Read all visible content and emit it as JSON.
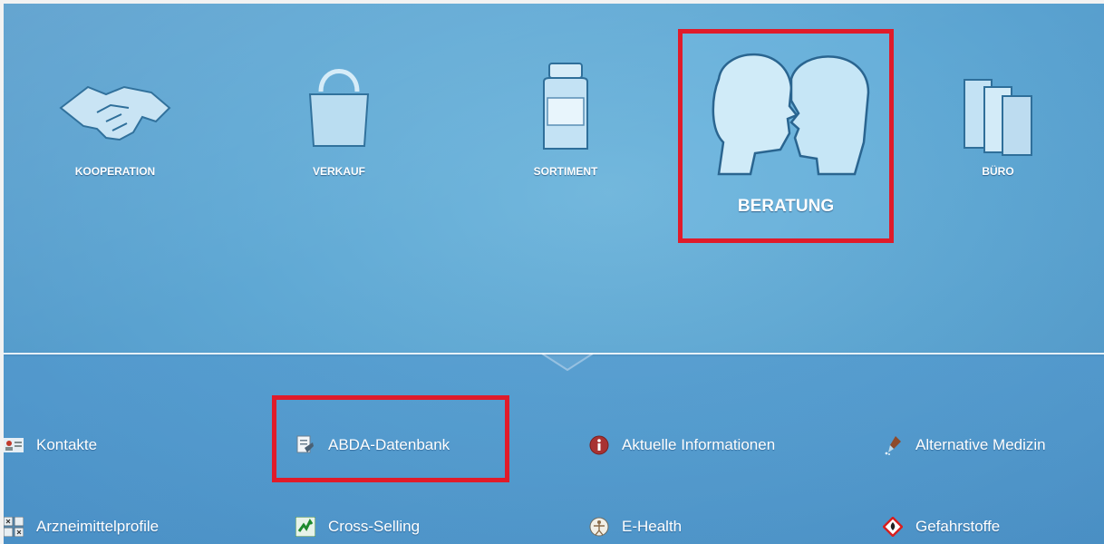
{
  "categories": [
    {
      "id": "kooperation",
      "label": "KOOPERATION",
      "icon": "handshake-icon"
    },
    {
      "id": "verkauf",
      "label": "VERKAUF",
      "icon": "shopping-bag-icon"
    },
    {
      "id": "sortiment",
      "label": "SORTIMENT",
      "icon": "medicine-bottle-icon"
    },
    {
      "id": "beratung",
      "label": "BERATUNG",
      "icon": "two-heads-icon",
      "selected": true
    },
    {
      "id": "buero",
      "label": "BÜRO",
      "icon": "binders-icon"
    }
  ],
  "submenu": {
    "items": [
      {
        "label": "Kontakte",
        "icon": "contact-card-icon"
      },
      {
        "label": "ABDA-Datenbank",
        "icon": "database-document-icon",
        "highlighted": true
      },
      {
        "label": "Aktuelle Informationen",
        "icon": "info-icon"
      },
      {
        "label": "Alternative Medizin",
        "icon": "dropper-icon"
      },
      {
        "label": "Arzneimittelprofile",
        "icon": "profile-grid-icon"
      },
      {
        "label": "Cross-Selling",
        "icon": "cross-selling-icon"
      },
      {
        "label": "E-Health",
        "icon": "vitruvian-man-icon"
      },
      {
        "label": "Gefahrstoffe",
        "icon": "hazard-icon"
      }
    ]
  },
  "colors": {
    "highlight": "#e01b2a",
    "background": "#5fa8d4",
    "text": "#ffffff"
  }
}
